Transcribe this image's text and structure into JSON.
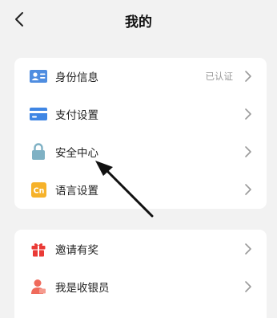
{
  "header": {
    "title": "我的",
    "back_icon": "chevron-left-icon"
  },
  "colors": {
    "background": "#f2f2f2",
    "card": "#ffffff",
    "identity_icon": "#4f8de0",
    "payment_icon": "#3f86e4",
    "security_icon": "#7fb1c4",
    "language_icon": "#f6b22a",
    "gift_icon": "#ea3a36",
    "cashier_icon": "#ef6a5b",
    "muted_text": "#999999",
    "chevron": "#9a9a9a"
  },
  "settings_card": {
    "items": [
      {
        "label": "身份信息",
        "value": "已认证",
        "icon": "id-card-icon"
      },
      {
        "label": "支付设置",
        "icon": "credit-card-icon"
      },
      {
        "label": "安全中心",
        "icon": "lock-icon"
      },
      {
        "label": "语言设置",
        "icon": "language-icon",
        "icon_text": "Cn"
      }
    ]
  },
  "rewards_card": {
    "items": [
      {
        "label": "邀请有奖",
        "icon": "gift-icon"
      },
      {
        "label": "我是收银员",
        "icon": "cashier-icon"
      }
    ]
  }
}
